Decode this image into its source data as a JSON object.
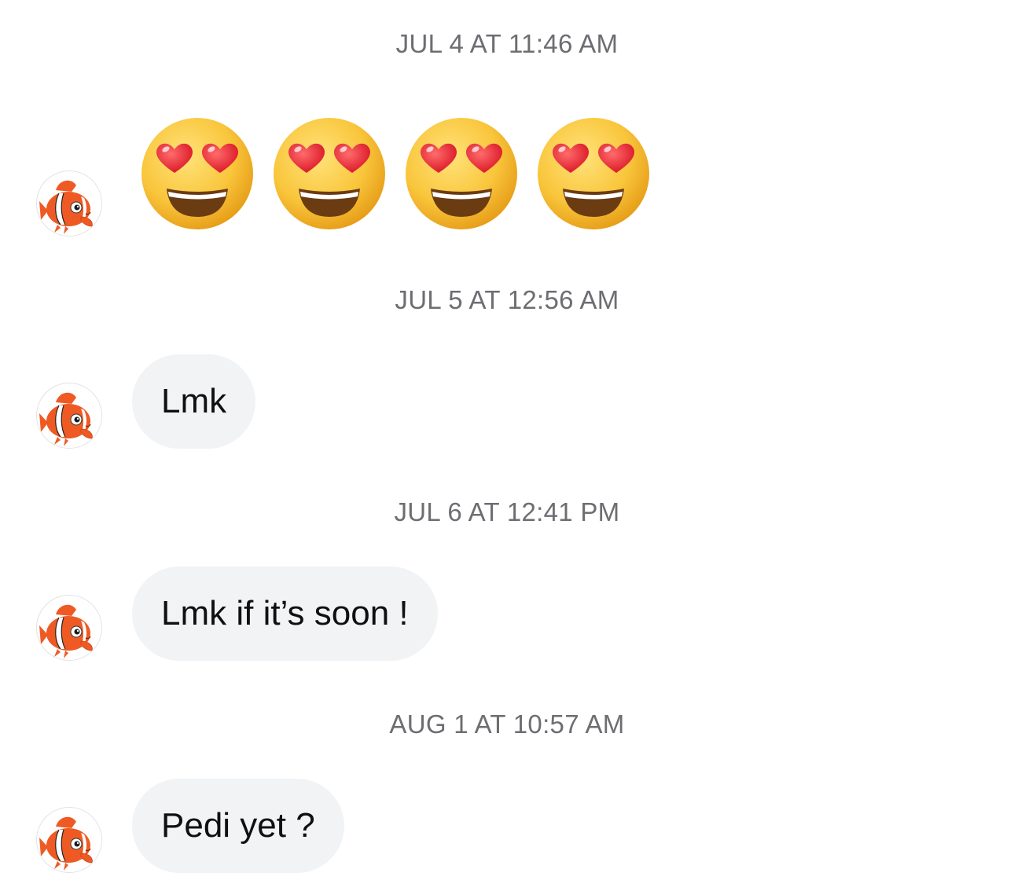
{
  "thread": {
    "messages": [
      {
        "timestamp": "JUL 4 AT 11:46 AM",
        "kind": "emoji",
        "emoji_count": 4,
        "emoji_name": "smiling-face-with-heart-eyes"
      },
      {
        "timestamp": "JUL 5 AT 12:56 AM",
        "kind": "text",
        "text": "Lmk"
      },
      {
        "timestamp": "JUL 6 AT 12:41 PM",
        "kind": "text",
        "text": "Lmk if it’s soon !"
      },
      {
        "timestamp": "AUG 1 AT 10:57 AM",
        "kind": "text",
        "text": "Pedi yet ?"
      }
    ],
    "avatar_icon": "clownfish-avatar-icon"
  },
  "colors": {
    "timestamp": "#6d6e72",
    "bubble_bg": "#f2f3f5",
    "bubble_text": "#101010",
    "emoji_face": "#f8c43a",
    "heart": "#ef2b3c",
    "fish_orange": "#ef5a24"
  }
}
